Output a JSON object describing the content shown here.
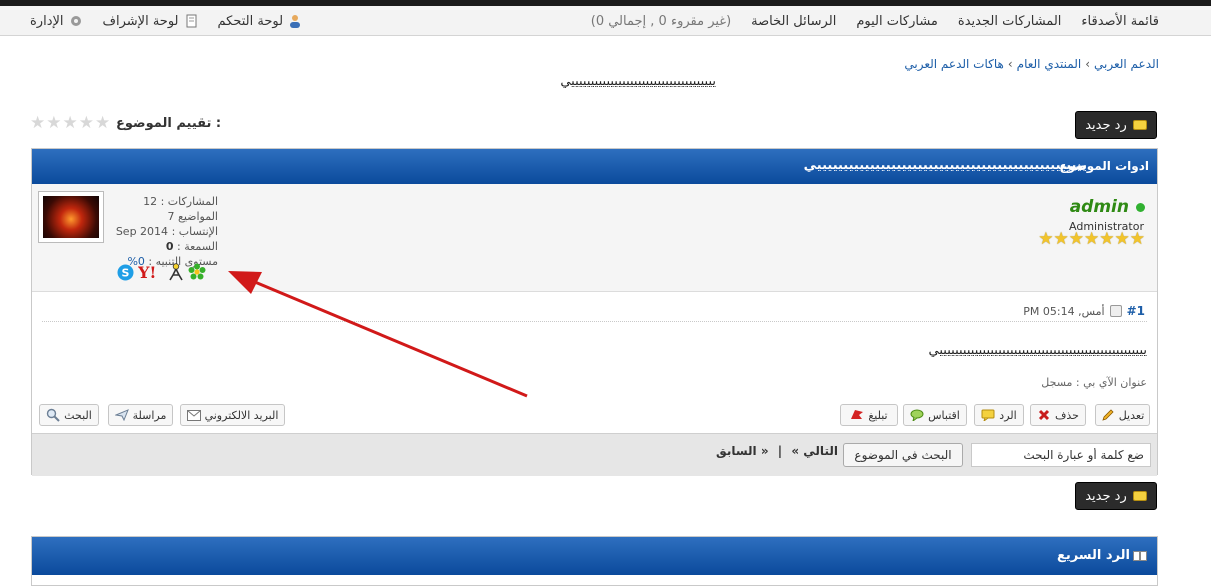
{
  "navbar": {
    "right_items": [
      "قائمة الأصدقاء",
      "المشاركات الجديدة",
      "مشاركات اليوم",
      "الرسائل الخاصة",
      "(غير مقروء 0 , إجمالي 0)"
    ],
    "left_items": [
      {
        "label": "لوحة التحكم",
        "icon": "user-icon"
      },
      {
        "label": "لوحة الإشراف",
        "icon": "notebook-icon"
      },
      {
        "label": "الإدارة",
        "icon": "gear-icon"
      }
    ]
  },
  "breadcrumb": [
    "الدعم العربي",
    "المنتدي العام",
    "هاكات الدعم العربي"
  ],
  "thread_title": "يييييييييييييييييييييييييييييييييييييي",
  "rating": {
    "label": "تقييم الموضوع :",
    "stars": 5
  },
  "reply_button": "رد جديد",
  "post": {
    "tools_label": "ادوات الموضوع",
    "title": "يييييييييييييييييييييييييييييييييييييييييييييييييييي",
    "user": {
      "name": "admin",
      "role": "Administrator",
      "rank_stars": 7,
      "stats": [
        {
          "label": "المشاركات :",
          "value": "12"
        },
        {
          "label": "المواضيع",
          "value": "7"
        },
        {
          "label": "الإنتساب :",
          "value": "Sep 2014"
        },
        {
          "label": "السمعة :",
          "value": "0"
        },
        {
          "label": "مستوى التنبيه :",
          "value": "0%"
        }
      ],
      "im_icons": [
        "skype-icon",
        "yahoo-icon",
        "aim-icon",
        "icq-icon"
      ]
    },
    "number": "#1",
    "date": "أمس, 05:14 PM",
    "body": "يييييييييييييييييييييييييييييييييييييييييييييييييييييي",
    "ip_line": "عنوان الآي بي : مسجل",
    "action_buttons": [
      "تعديل",
      "حذف",
      "الرد",
      "اقتباس",
      "تبليغ"
    ],
    "contact_buttons": [
      "البريد الالكتروني",
      "مراسلة",
      "البحث"
    ]
  },
  "thread_search": {
    "placeholder": "ضع كلمة أو عبارة البحث",
    "button": "البحث في الموضوع",
    "prev": "« السابق",
    "sep": "|",
    "next": "التالي »"
  },
  "quick_reply": {
    "title": "الرد السريع"
  }
}
